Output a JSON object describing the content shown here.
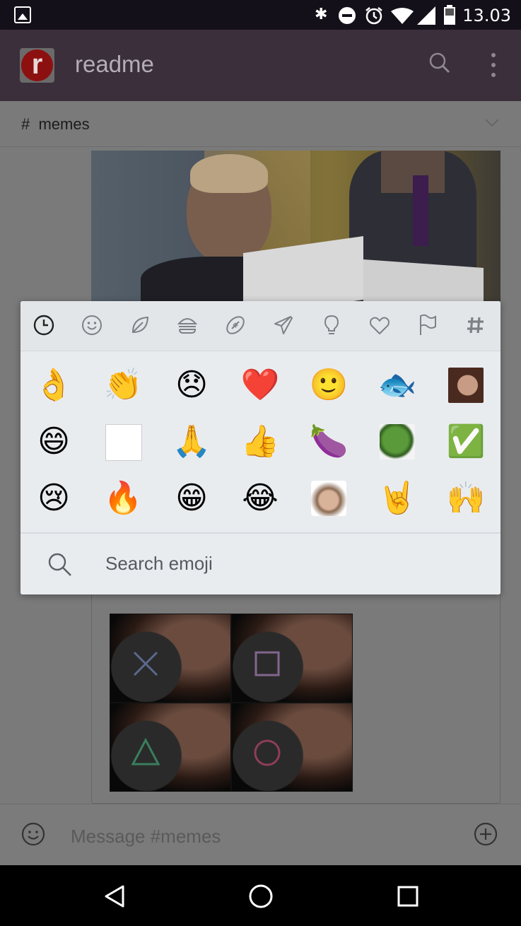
{
  "status_bar": {
    "time": "13.03",
    "bt_icon": "bluetooth-icon",
    "dnd_icon": "do-not-disturb-icon",
    "alarm_icon": "alarm-icon",
    "wifi_icon": "wifi-icon",
    "signal_icon": "signal-icon",
    "battery_icon": "battery-icon"
  },
  "app_bar": {
    "logo_letter": "r",
    "title": "readme"
  },
  "channel": {
    "name": "#  memes"
  },
  "emoji_picker": {
    "tabs": [
      "recent",
      "smileys",
      "nature",
      "food",
      "activity",
      "travel",
      "objects",
      "symbols",
      "flags",
      "custom"
    ],
    "emojis": [
      {
        "char": "👌",
        "name": "ok-hand-emoji"
      },
      {
        "char": "👏",
        "name": "clapping-hands-emoji"
      },
      {
        "char": "😞",
        "name": "disappointed-face-emoji"
      },
      {
        "char": "❤️",
        "name": "red-heart-emoji"
      },
      {
        "char": "🙂",
        "name": "slightly-smiling-face-emoji"
      },
      {
        "char": "🐟",
        "name": "fish-emoji"
      },
      {
        "char": "",
        "name": "custom-face-emoji-1"
      },
      {
        "char": "😄",
        "name": "grinning-face-emoji"
      },
      {
        "char": "",
        "name": "custom-sketch-emoji"
      },
      {
        "char": "🙏",
        "name": "folded-hands-emoji"
      },
      {
        "char": "👍",
        "name": "thumbs-up-emoji"
      },
      {
        "char": "🍆",
        "name": "eggplant-emoji"
      },
      {
        "char": "",
        "name": "custom-pepe-emoji"
      },
      {
        "char": "✅",
        "name": "check-mark-emoji"
      },
      {
        "char": "😢",
        "name": "crying-face-emoji"
      },
      {
        "char": "🔥",
        "name": "fire-emoji"
      },
      {
        "char": "😁",
        "name": "beaming-face-emoji"
      },
      {
        "char": "😂",
        "name": "tears-of-joy-emoji"
      },
      {
        "char": "",
        "name": "custom-face-emoji-2"
      },
      {
        "char": "🤘",
        "name": "sign-of-horns-emoji"
      },
      {
        "char": "🙌",
        "name": "raising-hands-emoji"
      }
    ],
    "search_placeholder": "Search emoji"
  },
  "composer": {
    "placeholder": "Message #memes"
  },
  "colors": {
    "app_bar": "#3a2f3b",
    "picker_bg": "#e9ecef",
    "logo_red": "#8d1010"
  }
}
